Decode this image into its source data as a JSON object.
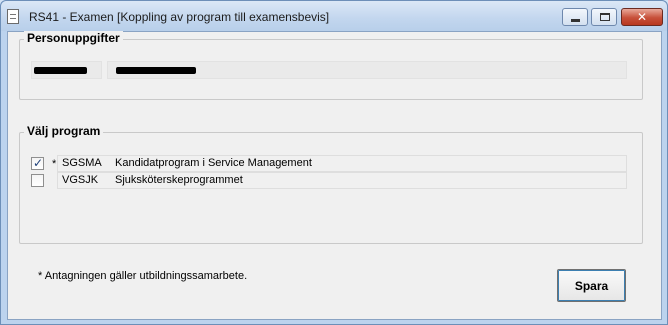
{
  "window": {
    "title": "RS41 - Examen [Koppling av program till examensbevis]",
    "icon": "document-icon",
    "controls": {
      "minimize": "_",
      "maximize": "□",
      "close": "✕"
    }
  },
  "personal": {
    "legend": "Personuppgifter",
    "id_value": "",
    "name_value": ""
  },
  "programs": {
    "legend": "Välj program",
    "rows": [
      {
        "checked": true,
        "marker": "*",
        "code": "SGSMA",
        "name": "Kandidatprogram i Service Management",
        "check_glyph": "✓"
      },
      {
        "checked": false,
        "marker": "",
        "code": "VGSJK",
        "name": "Sjuksköterskeprogrammet",
        "check_glyph": ""
      }
    ]
  },
  "footnote": "* Antagningen gäller utbildningssamarbete.",
  "actions": {
    "save_label": "Spara"
  }
}
